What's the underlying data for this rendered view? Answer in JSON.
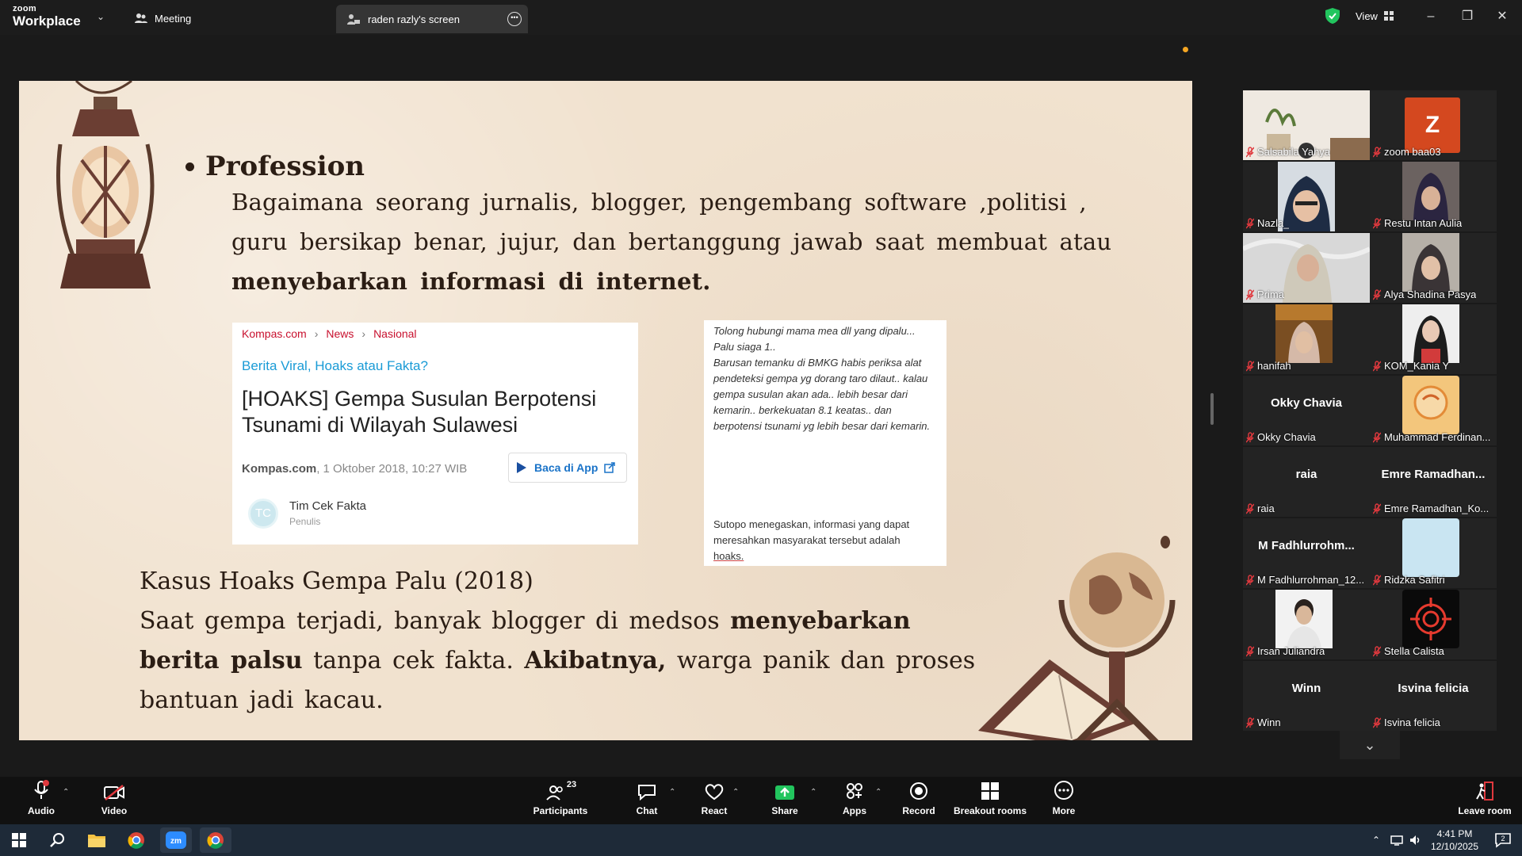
{
  "titlebar": {
    "brand_top": "zoom",
    "brand_bottom": "Workplace",
    "meeting_tab": "Meeting",
    "share_tab": "raden razly's screen",
    "view_label": "View"
  },
  "slide": {
    "heading": "Profession",
    "body_lines": [
      "Bagaimana seorang jurnalis, blogger, pengembang software ,politisi ,",
      "guru bersikap benar, jujur, dan bertanggung jawab saat membuat atau"
    ],
    "body_bold": "menyebarkan informasi di internet.",
    "news": {
      "crumbs": [
        "Kompas.com",
        "News",
        "Nasional"
      ],
      "kicker": "Berita Viral, Hoaks atau Fakta?",
      "title": "[HOAKS] Gempa Susulan Berpotensi Tsunami di Wilayah Sulawesi",
      "source": "Kompas.com",
      "date": ", 1 Oktober 2018, 10:27 WIB",
      "app_button": "Baca di App",
      "avatar": "TC",
      "author": "Tim Cek Fakta",
      "role": "Penulis"
    },
    "message": {
      "text": "Tolong hubungi mama mea dll yang dipalu...\nPalu siaga 1..\nBarusan temanku di BMKG habis periksa alat pendeteksi gempa yg dorang taro dilaut.. kalau gempa susulan akan ada.. lebih besar dari kemarin.. berkekuatan 8.1 keatas.. dan berpotensi tsunami yg lebih besar dari kemarin.",
      "footer": "Sutopo menegaskan, informasi yang dapat meresahkan masyarakat tersebut adalah",
      "footer_end": "hoaks."
    },
    "case_title": "Kasus Hoaks Gempa Palu (2018)",
    "case": {
      "l1a": "Saat gempa terjadi, banyak blogger di medsos ",
      "l1b": "menyebarkan",
      "l2a": "berita palsu",
      "l2b": " tanpa cek fakta. ",
      "l2c": "Akibatnya,",
      "l2d": " warga panik dan proses",
      "l3": "bantuan jadi kacau."
    }
  },
  "participants": [
    {
      "name": "Salsabila Yahya",
      "big": ""
    },
    {
      "name": "zoom baa03",
      "big": "",
      "initial": "Z"
    },
    {
      "name": "Nazla_",
      "big": ""
    },
    {
      "name": "Restu Intan Aulia",
      "big": ""
    },
    {
      "name": "Prima",
      "big": ""
    },
    {
      "name": "Alya Shadina Pasya",
      "big": ""
    },
    {
      "name": "hanifah",
      "big": ""
    },
    {
      "name": "KOM_Kania Y",
      "big": ""
    },
    {
      "name": "Okky Chavia",
      "big": "Okky Chavia"
    },
    {
      "name": "Muhammad Ferdinan...",
      "big": ""
    },
    {
      "name": "raia",
      "big": "raia"
    },
    {
      "name": "Emre Ramadhan_Ko...",
      "big": "Emre  Ramadhan..."
    },
    {
      "name": "M Fadhlurrohman_12...",
      "big": "M  Fadhlurrohm..."
    },
    {
      "name": "Ridzka Safitri",
      "big": ""
    },
    {
      "name": "Irsan Juliandra",
      "big": ""
    },
    {
      "name": "Stella Calista",
      "big": ""
    },
    {
      "name": "Winn",
      "big": "Winn"
    },
    {
      "name": "Isvina felicia",
      "big": "Isvina felicia"
    }
  ],
  "toolbar": {
    "audio": "Audio",
    "video": "Video",
    "participants": "Participants",
    "participants_count": "23",
    "chat": "Chat",
    "react": "React",
    "share": "Share",
    "apps": "Apps",
    "record": "Record",
    "breakout": "Breakout rooms",
    "more": "More",
    "leave": "Leave room"
  },
  "taskbar": {
    "time": "4:41 PM",
    "date": "12/10/2025",
    "notifications": "2"
  },
  "colors": {
    "accent_green": "#2ecc71",
    "share_green": "#22c55e",
    "mute_red": "#e0393e",
    "slide_bg": "#f1e2cf"
  }
}
